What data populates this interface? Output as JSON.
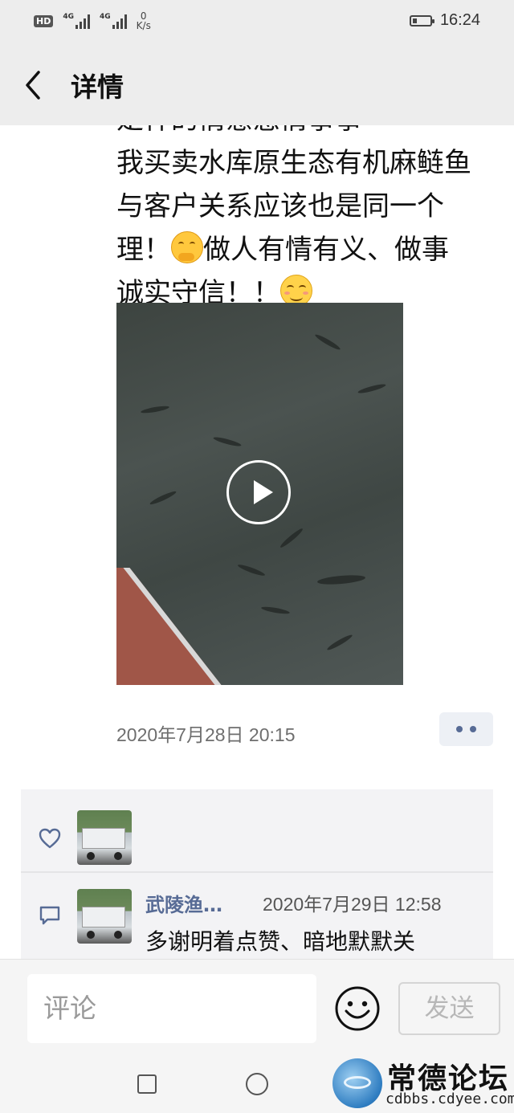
{
  "status_bar": {
    "hd_label": "HD",
    "net1": "4G",
    "net2": "4G",
    "speed_value": "0",
    "speed_unit": "K/s",
    "time": "16:24",
    "battery_level": 0.25
  },
  "header": {
    "title": "详情"
  },
  "post": {
    "text_line0": "是样的情意感情事事",
    "text_line1": "我买卖水库原生态有机麻鲢鱼",
    "text_line2": "与客户关系应该也是同一个",
    "text_line3a": "理！",
    "text_line3b": "做人有情有义、做事",
    "text_line4": "诚实守信！！",
    "emoji1": "thinking-emoji",
    "emoji2": "smile-emoji",
    "time": "2020年7月28日 20:15"
  },
  "likes": {
    "icon": "heart-icon"
  },
  "comment": {
    "icon": "comment-icon",
    "name": "武陵渔…",
    "time": "2020年7月29日 12:58",
    "text": "多谢明着点赞、暗地默默关"
  },
  "input_bar": {
    "placeholder": "评论",
    "send_label": "发送"
  },
  "watermark": {
    "title": "常德论坛",
    "url": "cdbbs.cdyee.com"
  },
  "colors": {
    "link": "#576b95",
    "header_bg": "#ededed",
    "panel_bg": "#f3f3f5"
  }
}
